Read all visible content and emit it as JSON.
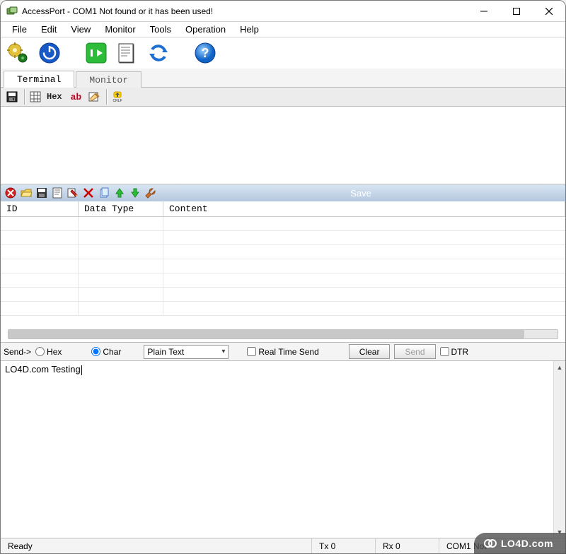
{
  "window": {
    "title": "AccessPort - COM1 Not found or it has been used!"
  },
  "menu": {
    "items": [
      "File",
      "Edit",
      "View",
      "Monitor",
      "Tools",
      "Operation",
      "Help"
    ]
  },
  "tabs": {
    "terminal": "Terminal",
    "monitor": "Monitor",
    "active": "terminal"
  },
  "subtoolbar": {
    "hex_label": "Hex",
    "ab_label": "ab"
  },
  "midtoolbar": {
    "save_label": "Save"
  },
  "table": {
    "headers": {
      "id": "ID",
      "type": "Data Type",
      "content": "Content"
    }
  },
  "send": {
    "label": "Send->",
    "hex": "Hex",
    "char": "Char",
    "selected": "char",
    "format_selected": "Plain Text",
    "realtime": "Real Time Send",
    "realtime_checked": false,
    "clear": "Clear",
    "send_btn": "Send",
    "dtr": "DTR",
    "dtr_checked": false,
    "input_text": "LO4D.com Testing"
  },
  "status": {
    "ready": "Ready",
    "tx": "Tx 0",
    "rx": "Rx 0",
    "port": "COM1 Not"
  },
  "watermark": "LO4D.com"
}
